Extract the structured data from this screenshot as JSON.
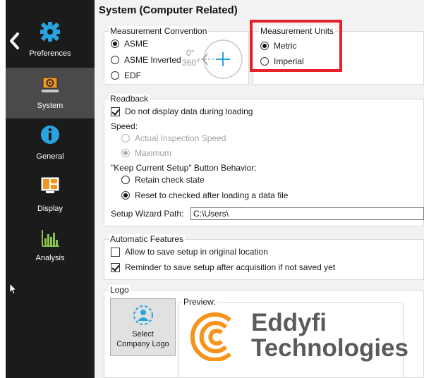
{
  "page_title": "System (Computer Related)",
  "sidebar": {
    "items": [
      {
        "label": "Preferences",
        "icon": "gear-icon"
      },
      {
        "label": "System",
        "icon": "monitor-gear-icon"
      },
      {
        "label": "General",
        "icon": "info-icon"
      },
      {
        "label": "Display",
        "icon": "display-layout-icon"
      },
      {
        "label": "Analysis",
        "icon": "bar-chart-icon"
      }
    ],
    "active": "System"
  },
  "measurement_convention": {
    "title": "Measurement Convention",
    "options": [
      "ASME",
      "ASME Inverted",
      "EDF"
    ],
    "selected": "ASME",
    "diagram_top": "0°",
    "diagram_left": "360°"
  },
  "measurement_units": {
    "title": "Measurement Units",
    "options": [
      "Metric",
      "Imperial"
    ],
    "selected": "Metric"
  },
  "readback": {
    "title": "Readback",
    "no_display_label": "Do not display data during loading",
    "no_display_checked": true,
    "speed_label": "Speed:",
    "speed_options": [
      "Actual Inspection Speed",
      "Maximum"
    ],
    "speed_selected": "Maximum",
    "keep_setup_label": "\"Keep Current Setup\" Button Behavior:",
    "keep_setup_options": [
      "Retain check state",
      "Reset to checked after loading a data file"
    ],
    "keep_setup_selected": "Reset to checked after loading a data file",
    "wizard_path_label": "Setup Wizard Path:",
    "wizard_path_value": "C:\\Users\\"
  },
  "automatic_features": {
    "title": "Automatic Features",
    "allow_save_label": "Allow to save setup in original location",
    "allow_save_checked": false,
    "reminder_label": "Reminder to save setup after acquisition if not saved yet",
    "reminder_checked": true
  },
  "logo": {
    "title": "Logo",
    "select_line1": "Select",
    "select_line2": "Company Logo",
    "preview_title": "Preview:",
    "company_line1": "Eddyfi",
    "company_line2": "Technologies"
  },
  "colors": {
    "accent": "#29a3e0",
    "highlight": "#e8202a",
    "logo_orange": "#f7941d",
    "logo_gray": "#5b5b5b"
  }
}
